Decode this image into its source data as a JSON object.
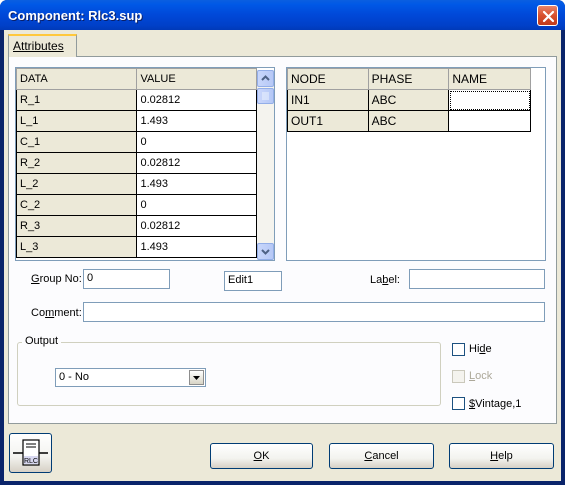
{
  "window": {
    "title": "Component: Rlc3.sup"
  },
  "tabs": [
    {
      "label": "Attributes"
    }
  ],
  "params_table": {
    "headers": [
      "DATA",
      "VALUE"
    ],
    "rows": [
      {
        "name": "R_1",
        "value": "0.02812"
      },
      {
        "name": "L_1",
        "value": "1.493"
      },
      {
        "name": "C_1",
        "value": "0"
      },
      {
        "name": "R_2",
        "value": "0.02812"
      },
      {
        "name": "L_2",
        "value": "1.493"
      },
      {
        "name": "C_2",
        "value": "0"
      },
      {
        "name": "R_3",
        "value": "0.02812"
      },
      {
        "name": "L_3",
        "value": "1.493"
      }
    ]
  },
  "node_table": {
    "headers": [
      "NODE",
      "PHASE",
      "NAME"
    ],
    "rows": [
      {
        "node": "IN1",
        "phase": "ABC",
        "name": ""
      },
      {
        "node": "OUT1",
        "phase": "ABC",
        "name": ""
      }
    ]
  },
  "form": {
    "group_no_label": "Group No:",
    "group_no_value": "0",
    "edit_value": "Edit1",
    "label_label": "Label:",
    "label_value": "",
    "comment_label": "Comment:",
    "comment_value": ""
  },
  "output": {
    "title": "Output",
    "selected": "0 - No"
  },
  "checkboxes": {
    "hide": "Hide",
    "lock": "Lock",
    "vintage": "$Vintage,1"
  },
  "buttons": {
    "ok": "OK",
    "cancel": "Cancel",
    "help": "Help",
    "icon_text": "RLC"
  },
  "icons": [
    "close-icon",
    "scroll-up-icon",
    "scroll-down-icon",
    "dropdown-arrow-icon",
    "rlc-component-icon"
  ]
}
